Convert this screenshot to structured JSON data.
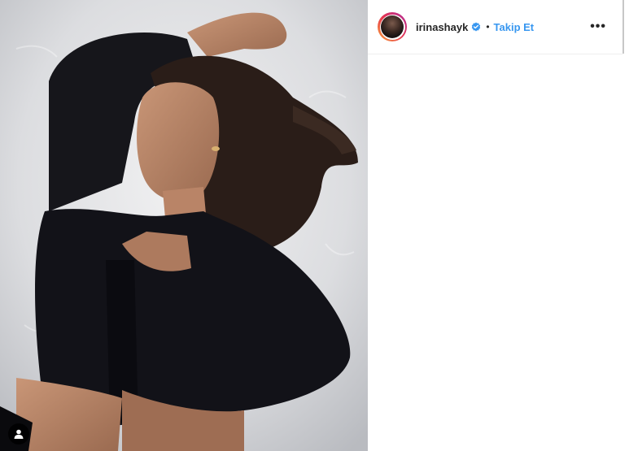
{
  "post": {
    "image_icon": "photo",
    "tag_icon": "user-tag-icon"
  },
  "header": {
    "username": "irinashayk",
    "verified_icon": "verified-badge-icon",
    "separator": "•",
    "follow_label": "Takip Et",
    "more_label": "•••"
  },
  "colors": {
    "follow": "#3897f0",
    "verified": "#3897f0",
    "username": "#262626"
  }
}
